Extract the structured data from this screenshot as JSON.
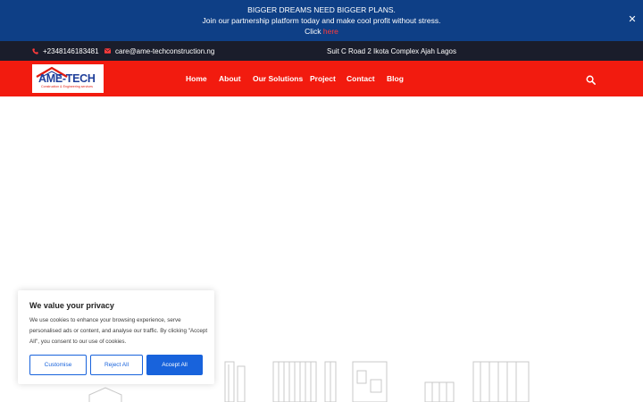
{
  "announcement": {
    "line1": "BIGGER DREAMS NEED BIGGER PLANS.",
    "line2": "Join our partnership platform today and make cool profit without stress.",
    "click_prefix": "Click ",
    "link_text": "here",
    "close_icon": "close-icon"
  },
  "contact": {
    "phone": "+2348146183481",
    "email": "care@ame-techconstruction.ng",
    "address": "Suit C Road 2 Ikota Complex Ajah Lagos",
    "phone_icon": "phone-icon",
    "email_icon": "envelope-icon"
  },
  "logo": {
    "text": "AME-TECH",
    "tagline": "Construction & Engineering services"
  },
  "nav": {
    "items": [
      {
        "label": "Home"
      },
      {
        "label": "About"
      },
      {
        "label": "Our Solutions"
      },
      {
        "label": "Project"
      },
      {
        "label": "Contact"
      },
      {
        "label": "Blog"
      }
    ],
    "search_icon": "search-icon"
  },
  "cookie": {
    "title": "We value your privacy",
    "text": "We use cookies to enhance your browsing experience, serve personalised ads or content, and analyse our traffic. By clicking \"Accept All\", you consent to our use of cookies.",
    "customise": "Customise",
    "reject": "Reject All",
    "accept": "Accept All"
  },
  "colors": {
    "announcement_bg": "#0e3f86",
    "contact_bg": "#1a1d2b",
    "header_bg": "#f21b0f",
    "accent_blue": "#1863dc"
  }
}
